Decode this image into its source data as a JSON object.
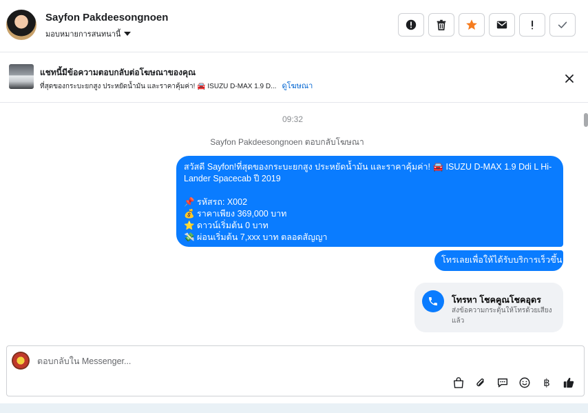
{
  "header": {
    "user_name": "Sayfon Pakdeesongnoen",
    "assign_label": "มอบหมายการสนทนานี้",
    "actions": [
      {
        "name": "report-spam-button",
        "icon": "alert-circle-icon"
      },
      {
        "name": "delete-button",
        "icon": "trash-icon"
      },
      {
        "name": "star-button",
        "icon": "star-icon"
      },
      {
        "name": "mark-unread-button",
        "icon": "envelope-icon"
      },
      {
        "name": "follow-up-button",
        "icon": "exclamation-icon"
      },
      {
        "name": "mark-done-button",
        "icon": "check-icon"
      }
    ]
  },
  "ad_context": {
    "title": "แชทนี้มีข้อความตอบกลับต่อโฆษณาของคุณ",
    "subtitle": "ที่สุดของกระบะยกสูง ประหยัดน้ำมัน และราคาคุ้มค่า! 🚘 ISUZU D-MAX 1.9 D...",
    "view_ad_link": "ดูโฆษณา"
  },
  "thread": {
    "timestamp": "09:32",
    "replied_note": "Sayfon Pakdeesongnoen ตอบกลับโฆษณา",
    "message": {
      "line1": "สวัสดี Sayfon!ที่สุดของกระบะยกสูง ประหยัดน้ำมัน และราคาคุ้มค่า! 🚘 ISUZU D-MAX 1.9 Ddi L Hi-Lander Spacecab ปี 2019",
      "line2": "📌 รหัสรถ: X002",
      "line3": "💰 ราคาเพียง 369,000 บาท",
      "line4": "⭐ ดาวน์เริ่มต้น 0 บาท",
      "line5": "💸 ผ่อนเริ่มต้น 7,xxx บาท ตลอดสัญญา"
    },
    "quick_reply": "โทรเลยเพื่อให้ได้รับบริการเร็วขึ้น",
    "call_card": {
      "title": "โทรหา โชคคูณโชคอุดร",
      "description": "ส่งข้อความกระตุ้นให้โทรด้วยเสียงแล้ว"
    }
  },
  "composer": {
    "placeholder": "ตอบกลับใน Messenger...",
    "tools": [
      "shop-bag-icon",
      "paperclip-icon",
      "saved-reply-icon",
      "emoji-icon",
      "baht-icon",
      "like-icon"
    ],
    "baht_symbol": "฿"
  },
  "colors": {
    "accent": "#0a7cff",
    "star": "#f57c1f",
    "link": "#0064d1"
  }
}
